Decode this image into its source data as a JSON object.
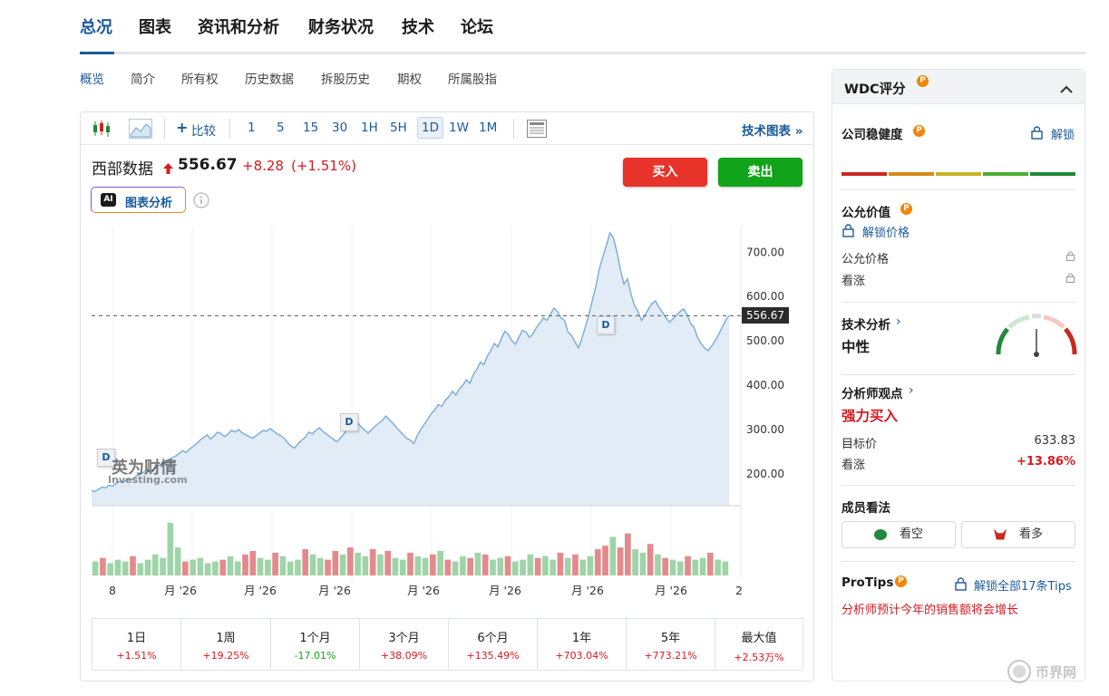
{
  "topnav": {
    "tabs": [
      "总况",
      "图表",
      "资讯和分析",
      "财务状况",
      "技术",
      "论坛"
    ]
  },
  "subnav": {
    "items": [
      "概览",
      "简介",
      "所有权",
      "历史数据",
      "拆股历史",
      "期权",
      "所属股指"
    ]
  },
  "toolbar": {
    "compare": "比较",
    "intervals": [
      "1",
      "5",
      "15",
      "30",
      "1H",
      "5H",
      "1D",
      "1W",
      "1M"
    ],
    "active_interval": "1D",
    "tech_chart": "技术图表 »"
  },
  "quote": {
    "name": "西部数据",
    "price": "556.67",
    "change": "+8.28",
    "change_pct": "(+1.51%)",
    "up_color": "#d71920"
  },
  "buttons": {
    "buy": "买入",
    "sell": "卖出"
  },
  "ai": {
    "badge": "AI",
    "label": "图表分析"
  },
  "chart_data": {
    "type": "area",
    "y_ticks": [
      "700.00",
      "600.00",
      "500.00",
      "400.00",
      "300.00",
      "200.00"
    ],
    "y_range": [
      130,
      760
    ],
    "x_labels": [
      "8",
      "月 '26",
      "月 '26",
      "月 '26",
      "月 '26",
      "月 '26",
      "月 '26",
      "月 '26",
      "2"
    ],
    "last_price_label": "556.67",
    "last_price": 556.67,
    "values": [
      162,
      160,
      165,
      170,
      168,
      174,
      172,
      178,
      183,
      180,
      188,
      186,
      190,
      196,
      200,
      204,
      208,
      206,
      212,
      218,
      222,
      228,
      232,
      236,
      240,
      246,
      252,
      248,
      256,
      262,
      268,
      276,
      282,
      288,
      278,
      286,
      294,
      290,
      284,
      290,
      298,
      294,
      300,
      292,
      288,
      284,
      280,
      286,
      292,
      298,
      296,
      302,
      296,
      290,
      286,
      280,
      270,
      262,
      258,
      268,
      276,
      282,
      294,
      290,
      298,
      304,
      296,
      290,
      284,
      278,
      272,
      280,
      290,
      300,
      310,
      318,
      314,
      306,
      298,
      292,
      300,
      308,
      314,
      320,
      330,
      322,
      314,
      305,
      296,
      288,
      280,
      276,
      268,
      286,
      300,
      312,
      324,
      336,
      344,
      356,
      352,
      366,
      374,
      386,
      378,
      392,
      400,
      412,
      404,
      424,
      436,
      452,
      446,
      466,
      478,
      494,
      486,
      506,
      522,
      514,
      500,
      492,
      508,
      524,
      520,
      508,
      516,
      530,
      540,
      552,
      546,
      560,
      574,
      566,
      552,
      546,
      520,
      512,
      498,
      484,
      506,
      532,
      560,
      592,
      624,
      664,
      690,
      716,
      744,
      732,
      700,
      660,
      628,
      640,
      606,
      580,
      566,
      546,
      558,
      572,
      584,
      590,
      576,
      564,
      552,
      542,
      550,
      558,
      566,
      572,
      560,
      540,
      530,
      508,
      494,
      484,
      478,
      488,
      500,
      514,
      530,
      546,
      556.67
    ],
    "volumes": [
      {
        "v": 8,
        "r": 0
      },
      {
        "v": 10,
        "r": 1
      },
      {
        "v": 7,
        "r": 0
      },
      {
        "v": 9,
        "r": 0
      },
      {
        "v": 8,
        "r": 0
      },
      {
        "v": 11,
        "r": 1
      },
      {
        "v": 7,
        "r": 0
      },
      {
        "v": 9,
        "r": 0
      },
      {
        "v": 12,
        "r": 0
      },
      {
        "v": 10,
        "r": 0
      },
      {
        "v": 30,
        "r": 0
      },
      {
        "v": 16,
        "r": 0
      },
      {
        "v": 8,
        "r": 1
      },
      {
        "v": 9,
        "r": 0
      },
      {
        "v": 10,
        "r": 0
      },
      {
        "v": 7,
        "r": 0
      },
      {
        "v": 8,
        "r": 0
      },
      {
        "v": 9,
        "r": 1
      },
      {
        "v": 11,
        "r": 0
      },
      {
        "v": 8,
        "r": 0
      },
      {
        "v": 12,
        "r": 1
      },
      {
        "v": 14,
        "r": 1
      },
      {
        "v": 10,
        "r": 0
      },
      {
        "v": 9,
        "r": 0
      },
      {
        "v": 13,
        "r": 1
      },
      {
        "v": 11,
        "r": 0
      },
      {
        "v": 8,
        "r": 0
      },
      {
        "v": 9,
        "r": 0
      },
      {
        "v": 15,
        "r": 1
      },
      {
        "v": 12,
        "r": 0
      },
      {
        "v": 10,
        "r": 0
      },
      {
        "v": 9,
        "r": 1
      },
      {
        "v": 14,
        "r": 1
      },
      {
        "v": 12,
        "r": 0
      },
      {
        "v": 16,
        "r": 1
      },
      {
        "v": 13,
        "r": 0
      },
      {
        "v": 11,
        "r": 0
      },
      {
        "v": 15,
        "r": 1
      },
      {
        "v": 12,
        "r": 0
      },
      {
        "v": 14,
        "r": 1
      },
      {
        "v": 10,
        "r": 0
      },
      {
        "v": 9,
        "r": 0
      },
      {
        "v": 13,
        "r": 1
      },
      {
        "v": 11,
        "r": 0
      },
      {
        "v": 10,
        "r": 0
      },
      {
        "v": 12,
        "r": 1
      },
      {
        "v": 14,
        "r": 0
      },
      {
        "v": 9,
        "r": 1
      },
      {
        "v": 8,
        "r": 0
      },
      {
        "v": 11,
        "r": 0
      },
      {
        "v": 10,
        "r": 1
      },
      {
        "v": 13,
        "r": 0
      },
      {
        "v": 12,
        "r": 1
      },
      {
        "v": 9,
        "r": 0
      },
      {
        "v": 10,
        "r": 0
      },
      {
        "v": 11,
        "r": 1
      },
      {
        "v": 8,
        "r": 0
      },
      {
        "v": 9,
        "r": 0
      },
      {
        "v": 12,
        "r": 0
      },
      {
        "v": 10,
        "r": 1
      },
      {
        "v": 11,
        "r": 0
      },
      {
        "v": 9,
        "r": 0
      },
      {
        "v": 13,
        "r": 1
      },
      {
        "v": 10,
        "r": 0
      },
      {
        "v": 12,
        "r": 1
      },
      {
        "v": 9,
        "r": 0
      },
      {
        "v": 11,
        "r": 0
      },
      {
        "v": 15,
        "r": 1
      },
      {
        "v": 17,
        "r": 1
      },
      {
        "v": 22,
        "r": 0
      },
      {
        "v": 16,
        "r": 1
      },
      {
        "v": 24,
        "r": 1
      },
      {
        "v": 15,
        "r": 0
      },
      {
        "v": 13,
        "r": 0
      },
      {
        "v": 18,
        "r": 1
      },
      {
        "v": 12,
        "r": 0
      },
      {
        "v": 10,
        "r": 1
      },
      {
        "v": 9,
        "r": 0
      },
      {
        "v": 8,
        "r": 0
      },
      {
        "v": 11,
        "r": 1
      },
      {
        "v": 9,
        "r": 0
      },
      {
        "v": 10,
        "r": 0
      },
      {
        "v": 13,
        "r": 1
      },
      {
        "v": 9,
        "r": 0
      },
      {
        "v": 8,
        "r": 0
      }
    ]
  },
  "markers": {
    "d": "D"
  },
  "watermark": {
    "cn": "英为财情",
    "en": "Investing.com"
  },
  "performance": [
    {
      "period": "1日",
      "value": "+1.51%",
      "color": "#d71920"
    },
    {
      "period": "1周",
      "value": "+19.25%",
      "color": "#d71920"
    },
    {
      "period": "1个月",
      "value": "-17.01%",
      "color": "#11a31a"
    },
    {
      "period": "3个月",
      "value": "+38.09%",
      "color": "#d71920"
    },
    {
      "period": "6个月",
      "value": "+135.49%",
      "color": "#d71920"
    },
    {
      "period": "1年",
      "value": "+703.04%",
      "color": "#d71920"
    },
    {
      "period": "5年",
      "value": "+773.21%",
      "color": "#d71920"
    },
    {
      "period": "最大值",
      "value": "+2.53万%",
      "color": "#d71920"
    }
  ],
  "panel": {
    "title": "WDC评分",
    "health": {
      "label": "公司稳健度",
      "unlock": "解锁",
      "bars": [
        "#c9281f",
        "#d48a1a",
        "#c8b324",
        "#4aad34",
        "#1f8a3a"
      ]
    },
    "fair": {
      "label": "公允价值",
      "unlock_price": "解锁价格",
      "row1": "公允价格",
      "row2": "看涨"
    },
    "tech": {
      "label": "技术分析",
      "value": "中性"
    },
    "analyst": {
      "label": "分析师观点",
      "value": "强力买入",
      "target_label": "目标价",
      "target_value": "633.83",
      "upside_label": "看涨",
      "upside_value": "+13.86%"
    },
    "member": {
      "label": "成员看法",
      "bear": "看空",
      "bull": "看多"
    },
    "protips": {
      "label": "ProTips",
      "unlock_all": "解锁全部17条Tips",
      "tip": "分析师预计今年的销售额将会增长"
    }
  },
  "footer_logo": {
    "text": "币界网"
  },
  "colors": {
    "accent": "#1a5a9c",
    "up": "#d71920",
    "down": "#11a31a",
    "line": "#6fa3d4",
    "area": "#e1ecf6"
  }
}
